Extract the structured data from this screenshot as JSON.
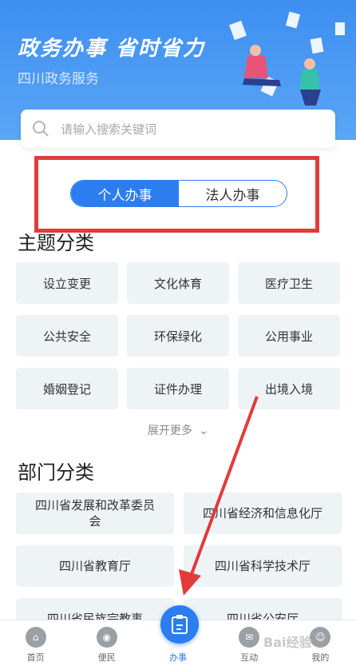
{
  "header": {
    "slogan": "政务办事  省时省力",
    "subtitle": "四川政务服务"
  },
  "search": {
    "placeholder": "请输入搜索关键词"
  },
  "toggle": {
    "personal": "个人办事",
    "legal": "法人办事"
  },
  "theme": {
    "title": "主题分类",
    "items": [
      "设立变更",
      "文化体育",
      "医疗卫生",
      "公共安全",
      "环保绿化",
      "公用事业",
      "婚姻登记",
      "证件办理",
      "出境入境"
    ],
    "more": "展开更多"
  },
  "dept": {
    "title": "部门分类",
    "items": [
      "四川省发展和改革委员会",
      "四川省经济和信息化厅",
      "四川省教育厅",
      "四川省科学技术厅",
      "四川省民族宗教事",
      "四川省公安厅"
    ]
  },
  "tabbar": {
    "home": "首页",
    "convenience": "便民",
    "affairs": "办事",
    "interact": "互动",
    "mine": "我的"
  },
  "colors": {
    "accent": "#2c7df0",
    "highlight_box": "#e23b3b",
    "arrow": "#e23b3b"
  },
  "watermark": "Bai经验"
}
